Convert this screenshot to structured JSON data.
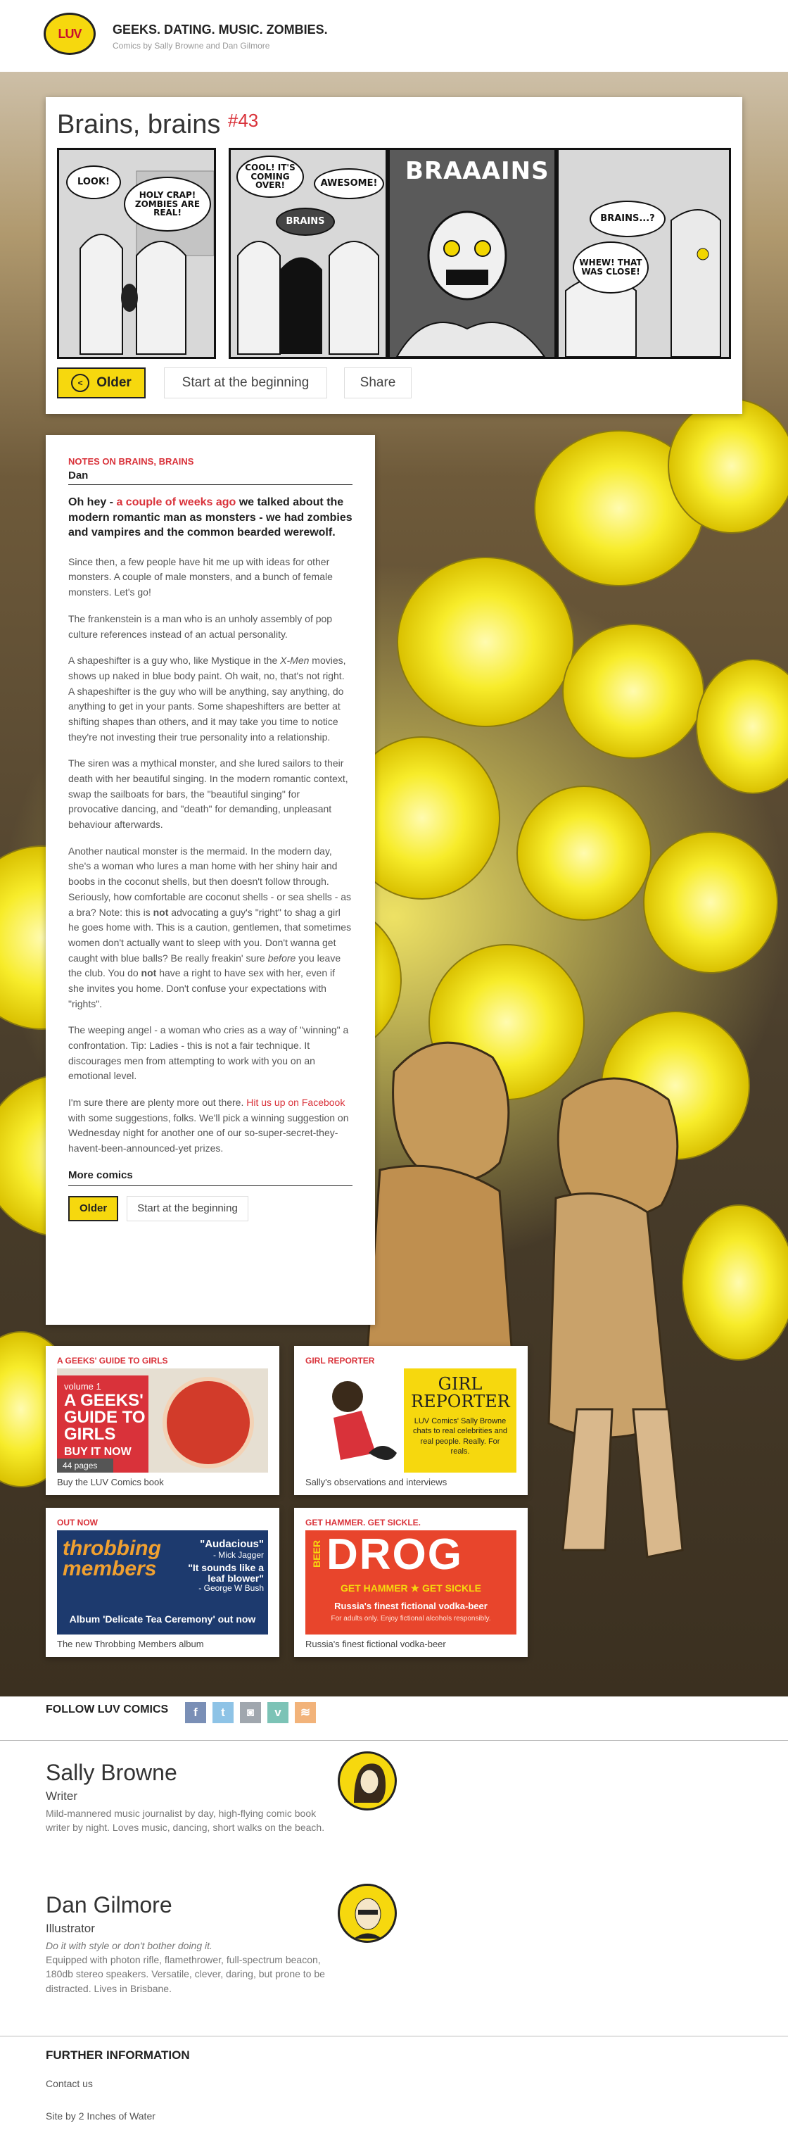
{
  "header": {
    "logo_text": "LUV",
    "title": "GEEKS. DATING. MUSIC. ZOMBIES.",
    "subtitle": "Comics by Sally Browne and Dan Gilmore"
  },
  "comic": {
    "title": "Brains, brains",
    "number": "#43",
    "panel1": {
      "bubble1": "LOOK!",
      "bubble2": "HOLY CRAP! ZOMBIES ARE REAL!"
    },
    "panel2": {
      "bubble1": "COOL! IT'S COMING OVER!",
      "bubble2": "AWESOME!",
      "bubble3": "BRAINS"
    },
    "panel3": {
      "shout": "BRAAAINS"
    },
    "panel4": {
      "bubble1": "BRAINS...?",
      "bubble2": "WHEW! THAT WAS CLOSE!"
    },
    "buttons": {
      "older": "Older",
      "start": "Start at the beginning",
      "share": "Share"
    }
  },
  "notes": {
    "heading": "NOTES ON BRAINS, BRAINS",
    "author": "Dan",
    "lead_pre": "Oh hey - ",
    "lead_link": "a couple of weeks ago",
    "lead_post": " we talked about the modern romantic man as monsters - we had zombies and vampires and the common bearded werewolf.",
    "p1": "Since then, a few people have hit me up with ideas for other monsters. A couple of male monsters, and a bunch of female monsters. Let's go!",
    "p2": "The frankenstein is a man who is an unholy assembly of pop culture references instead of an actual personality.",
    "p3_pre": "A shapeshifter is a guy who, like Mystique in the ",
    "p3_em": "X-Men",
    "p3_post": " movies, shows up naked in blue body paint. Oh wait, no, that's not right. A shapeshifter is the guy who will be anything, say anything, do anything to get in your pants. Some shapeshifters are better at shifting shapes than others, and it may take you time to notice they're not investing their true personality into a relationship.",
    "p4": "The siren was a mythical monster, and she lured sailors to their death with her beautiful singing. In the modern romantic context, swap the sailboats for bars, the \"beautiful singing\" for provocative dancing, and \"death\" for demanding, unpleasant behaviour afterwards.",
    "p5_a": "Another nautical monster is the mermaid. In the modern day, she's a woman who lures a man home with her shiny hair and boobs in the coconut shells, but then doesn't follow through. Seriously, how comfortable are coconut shells - or sea shells - as a bra? Note: this is ",
    "p5_b": "not",
    "p5_c": " advocating a guy's \"right\" to shag a girl he goes home with. This is a caution, gentlemen, that sometimes women don't actually want to sleep with you. Don't wanna get caught with blue balls? Be really freakin' sure ",
    "p5_d": "before",
    "p5_e": " you leave the club. You do ",
    "p5_f": "not",
    "p5_g": " have a right to have sex with her, even if she invites you home. Don't confuse your expectations with \"rights\".",
    "p6": "The weeping angel - a woman who cries as a way of \"winning\" a confrontation. Tip: Ladies - this is not a fair technique. It discourages men from attempting to work with you on an emotional level.",
    "p7_pre": "I'm sure there are plenty more out there. ",
    "p7_link": "Hit us up on Facebook",
    "p7_post": " with some suggestions, folks. We'll pick a winning suggestion on Wednesday night for another one of our so-super-secret-they-havent-been-announced-yet prizes.",
    "more_title": "More comics",
    "older": "Older",
    "start": "Start at the beginning"
  },
  "promos": [
    {
      "label": "A GEEKS' GUIDE TO GIRLS",
      "caption": "Buy the LUV Comics book",
      "art_vol": "volume 1",
      "art_title1": "A GEEKS'",
      "art_title2": "GUIDE TO",
      "art_title3": "GIRLS",
      "art_cta": "BUY IT NOW",
      "art_pages": "44 pages"
    },
    {
      "label": "GIRL REPORTER",
      "caption": "Sally's observations and interviews",
      "art_title1": "GIRL",
      "art_title2": "REPORTER",
      "art_text": "LUV Comics' Sally Browne chats to real celebrities and real people. Really. For reals."
    },
    {
      "label": "OUT NOW",
      "caption": "The new Throbbing Members album",
      "art_band1": "throbbing",
      "art_band2": "members",
      "art_q1": "\"Audacious\"",
      "art_a1": "- Mick Jagger",
      "art_q2": "\"It sounds like a leaf blower\"",
      "art_a2": "- George W Bush",
      "art_foot": "Album 'Delicate Tea Ceremony' out now"
    },
    {
      "label": "GET HAMMER. GET SICKLE.",
      "caption": "Russia's finest fictional vodka-beer",
      "art_side": "BEER",
      "art_brand": "DROG",
      "art_slogan": "GET HAMMER ★ GET SICKLE",
      "art_line": "Russia's finest fictional vodka-beer",
      "art_small": "For adults only. Enjoy fictional alcohols responsibly."
    }
  ],
  "follow": {
    "label": "FOLLOW LUV COMICS",
    "icons": [
      "facebook-icon",
      "twitter-icon",
      "instagram-icon",
      "vine-icon",
      "rss-icon"
    ]
  },
  "people": [
    {
      "name": "Sally Browne",
      "role": "Writer",
      "bio": "Mild-mannered music journalist by day, high-flying comic book writer by night. Loves music, dancing, short walks on the beach."
    },
    {
      "name": "Dan Gilmore",
      "role": "Illustrator",
      "quote": "Do it with style or don't bother doing it.",
      "bio": "Equipped with photon rifle, flamethrower, full-spectrum beacon, 180db stereo speakers. Versatile, clever, daring, but prone to be distracted. Lives in Brisbane."
    }
  ],
  "footer": {
    "heading": "FURTHER INFORMATION",
    "contact": "Contact us",
    "credit": "Site by 2 Inches of Water"
  },
  "colors": {
    "accent": "#d9323a",
    "brand_yellow": "#f6d80e",
    "facebook": "#7a8fb6",
    "twitter": "#8ec3e6",
    "instagram": "#a0a7ae",
    "vine": "#7cc3b6",
    "rss": "#f2b37a"
  }
}
